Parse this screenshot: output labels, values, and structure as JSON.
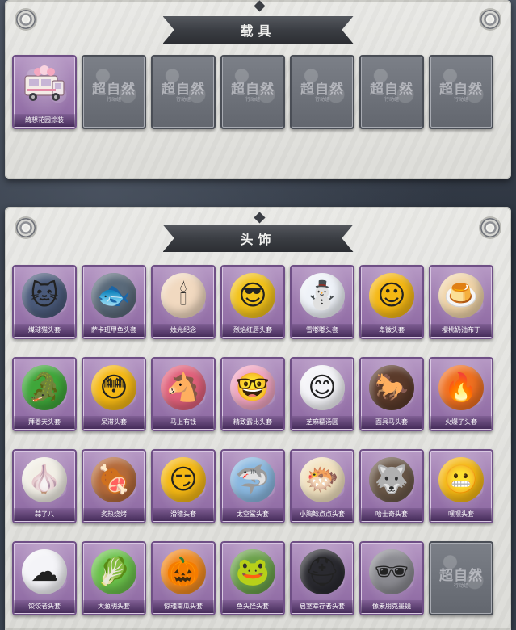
{
  "sections": {
    "vehicles": {
      "title": "载具",
      "items": [
        {
          "label": "绮想花园涂装",
          "icon": "ice-cream-truck-icon",
          "unlocked": true
        },
        {
          "label": "",
          "icon": "locked-placeholder",
          "unlocked": false
        },
        {
          "label": "",
          "icon": "locked-placeholder",
          "unlocked": false
        },
        {
          "label": "",
          "icon": "locked-placeholder",
          "unlocked": false
        },
        {
          "label": "",
          "icon": "locked-placeholder",
          "unlocked": false
        },
        {
          "label": "",
          "icon": "locked-placeholder",
          "unlocked": false
        },
        {
          "label": "",
          "icon": "locked-placeholder",
          "unlocked": false
        }
      ]
    },
    "headwear": {
      "title": "头饰",
      "items": [
        {
          "label": "煤球猫头套",
          "icon": "cat-head-icon",
          "glyph": "🐱",
          "color": "#4a5a7a"
        },
        {
          "label": "萨卡班甲鱼头套",
          "icon": "fish-head-icon",
          "glyph": "🐟",
          "color": "#5a6a7a"
        },
        {
          "label": "烛光纪念",
          "icon": "candle-icon",
          "glyph": "🕯",
          "color": "#f1d9c0"
        },
        {
          "label": "烈焰红唇头套",
          "icon": "yellow-lips-head-icon",
          "glyph": "😎",
          "color": "#f2c21a"
        },
        {
          "label": "雪嘟嘟头套",
          "icon": "snowman-head-icon",
          "glyph": "⛄",
          "color": "#eef2f8"
        },
        {
          "label": "卑微头套",
          "icon": "shy-emoji-head-icon",
          "glyph": "☺",
          "color": "#f5b814"
        },
        {
          "label": "樱桃奶油布丁",
          "icon": "pudding-head-icon",
          "glyph": "🍮",
          "color": "#f0d4a8"
        },
        {
          "label": "拜嚣天头套",
          "icon": "crocodile-head-icon",
          "glyph": "🐊",
          "color": "#3fa63a"
        },
        {
          "label": "呆滞头套",
          "icon": "stunned-emoji-head-icon",
          "glyph": "😳",
          "color": "#f5b814"
        },
        {
          "label": "马上有钱",
          "icon": "pink-horse-head-icon",
          "glyph": "🐴",
          "color": "#e0607a"
        },
        {
          "label": "精致露比头套",
          "icon": "pink-glasses-head-icon",
          "glyph": "🤓",
          "color": "#f0a4c0"
        },
        {
          "label": "芝麻糯汤圆",
          "icon": "dumpling-head-icon",
          "glyph": "😊",
          "color": "#f4f4f8"
        },
        {
          "label": "面具马头套",
          "icon": "horse-mask-icon",
          "glyph": "🐎",
          "color": "#5a3a2a"
        },
        {
          "label": "火爆了头套",
          "icon": "fire-head-icon",
          "glyph": "🔥",
          "color": "#f07020"
        },
        {
          "label": "蒜了八",
          "icon": "garlic-head-icon",
          "glyph": "🧄",
          "color": "#f2efe6"
        },
        {
          "label": "炙热烧烤",
          "icon": "bbq-head-icon",
          "glyph": "🍖",
          "color": "#b46a3a"
        },
        {
          "label": "滑稽头套",
          "icon": "grin-emoji-head-icon",
          "glyph": "😏",
          "color": "#f5b814"
        },
        {
          "label": "太空鲨头套",
          "icon": "shark-head-icon",
          "glyph": "🦈",
          "color": "#8ab8e0"
        },
        {
          "label": "小胸鲶点点头套",
          "icon": "axolotl-head-icon",
          "glyph": "🐡",
          "color": "#f2e2c0"
        },
        {
          "label": "哈士奇头套",
          "icon": "husky-head-icon",
          "glyph": "🐺",
          "color": "#6a5848"
        },
        {
          "label": "嘿嘿头套",
          "icon": "teeth-emoji-head-icon",
          "glyph": "😬",
          "color": "#f5b814"
        },
        {
          "label": "饺饺者头套",
          "icon": "cloud-head-icon",
          "glyph": "☁",
          "color": "#f4f4f8"
        },
        {
          "label": "大葱明头套",
          "icon": "bok-choy-head-icon",
          "glyph": "🥬",
          "color": "#6ac04a"
        },
        {
          "label": "惊魂南瓜头套",
          "icon": "pumpkin-head-icon",
          "glyph": "🎃",
          "color": "#f08a20"
        },
        {
          "label": "鱼头怪头套",
          "icon": "fish-monster-head-icon",
          "glyph": "🐸",
          "color": "#6aa04a"
        },
        {
          "label": "启室幸存者头套",
          "icon": "gas-mask-helmet-icon",
          "glyph": "⛑",
          "color": "#2a2a30"
        },
        {
          "label": "像素朋克墨镜",
          "icon": "pixel-sunglasses-icon",
          "glyph": "🕶",
          "color": "#8a8a90"
        },
        {
          "label": "",
          "icon": "locked-placeholder",
          "glyph": "",
          "color": "",
          "unlocked": false
        }
      ]
    }
  },
  "watermark": {
    "text": "超自然",
    "sub": "行动组"
  }
}
